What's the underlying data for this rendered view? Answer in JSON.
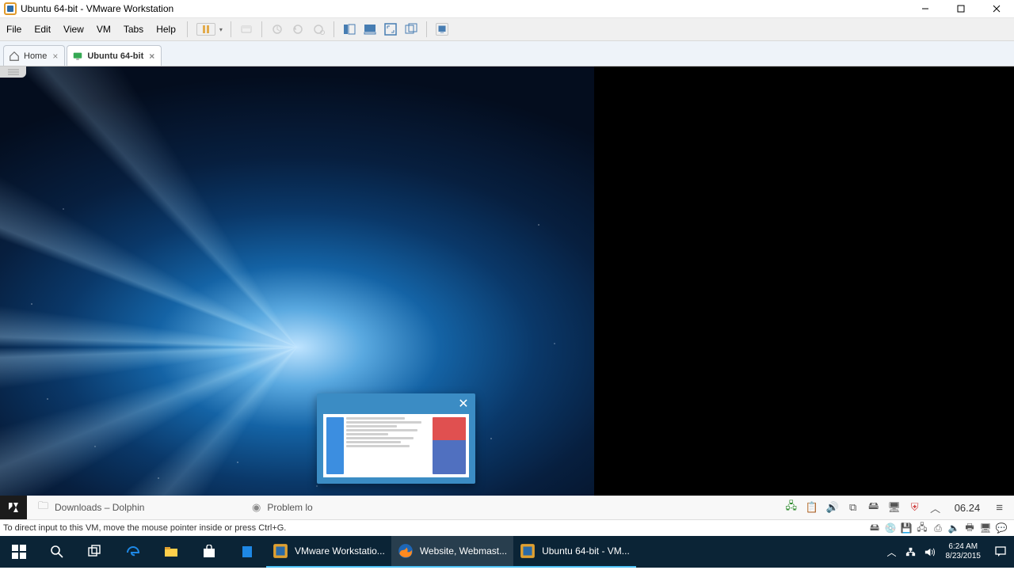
{
  "window": {
    "title": "Ubuntu 64-bit - VMware Workstation"
  },
  "menu": {
    "items": [
      "File",
      "Edit",
      "View",
      "VM",
      "Tabs",
      "Help"
    ]
  },
  "tabs": [
    {
      "label": "Home",
      "active": false
    },
    {
      "label": "Ubuntu 64-bit",
      "active": true
    }
  ],
  "kde": {
    "task1": "Downloads – Dolphin",
    "task2": "Problem lo",
    "clock": "06.24"
  },
  "vm_status": {
    "msg": "To direct input to this VM, move the mouse pointer inside or press Ctrl+G."
  },
  "win_tasks": [
    {
      "label": "VMware Workstatio...",
      "icon": "vmware"
    },
    {
      "label": "Website, Webmast...",
      "icon": "firefox"
    },
    {
      "label": "Ubuntu 64-bit - VM...",
      "icon": "vmware"
    }
  ],
  "win_tray": {
    "time": "6:24 AM",
    "date": "8/23/2015"
  }
}
